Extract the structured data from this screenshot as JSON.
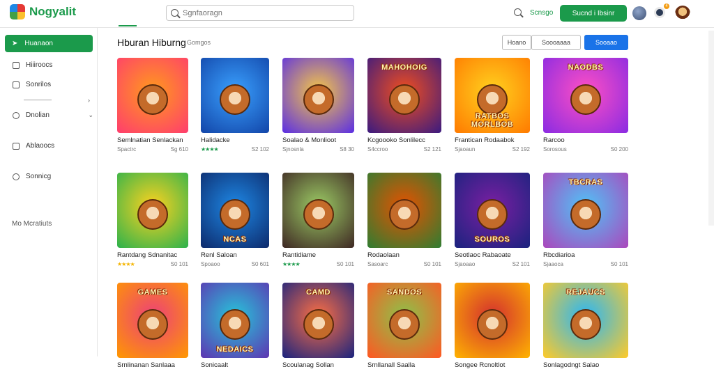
{
  "app": {
    "name": "Nogyalit"
  },
  "search": {
    "placeholder": "Sgnfaoragn"
  },
  "topbar": {
    "link": "Scnsgo",
    "button": "Sucnd i Ibsinr",
    "badge": "4"
  },
  "sidebar": {
    "active": "Huanaon",
    "items": [
      "Hiiiroocs",
      "Sonrilos",
      "Dnolian",
      "Ablaoocs",
      "Sonnicg"
    ],
    "sub": "—————",
    "footer": "Mo Mcratiuts"
  },
  "header": {
    "title": "Hburan Hiburng",
    "subtitle": "Gomgos"
  },
  "chips": [
    "Hoano",
    "Soooaaaa",
    "Sooaao"
  ],
  "colors": {
    "brand": "#1b9a4b",
    "primary": "#1a73e8"
  },
  "games": [
    {
      "title": "Semlnatian Senlackan",
      "rating": "Spactrc",
      "meta": "Sg 610",
      "icon": "bear-mascot-icon",
      "banner": "",
      "palette": [
        "#ff9a1c",
        "#ff3d6e"
      ]
    },
    {
      "title": "Halidacke",
      "rating": "★★★★",
      "meta": "S2 102",
      "icon": "robot-tank-icon",
      "banner": "",
      "palette": [
        "#3aa1ff",
        "#1245a8"
      ]
    },
    {
      "title": "Soalao & Monlioot",
      "rating": "Sjnosnla",
      "meta": "S8 30",
      "icon": "cannon-icon",
      "banner": "",
      "palette": [
        "#f7c845",
        "#5a2ee5"
      ]
    },
    {
      "title": "Kcgoooko Sonlilecc",
      "rating": "S4ccroo",
      "meta": "S2 121",
      "icon": "hero-character-icon",
      "banner": "MAHOHOIG",
      "palette": [
        "#f24e1e",
        "#3a1a80"
      ]
    },
    {
      "title": "Frantican Rodaabok",
      "rating": "Sjaoaun",
      "meta": "S2 192",
      "icon": "bear-tablet-icon",
      "banner": "RATBOS MORLBOB",
      "palette": [
        "#ffd21f",
        "#ff7a00"
      ]
    },
    {
      "title": "Rarcoo",
      "rating": "Sorosous",
      "meta": "S0 200",
      "icon": "bear-mascot-icon",
      "banner": "NAODBS",
      "palette": [
        "#ff4fc4",
        "#8a2be2"
      ]
    },
    {
      "title": "Rantdang Sdnanitac",
      "rating": "★★★★",
      "meta": "S0 101",
      "icon": "dice-icon",
      "banner": "",
      "palette": [
        "#ffd21f",
        "#2bb24c"
      ]
    },
    {
      "title": "Renl Saloan",
      "rating": "Spoaoo",
      "meta": "S0 601",
      "icon": "tablet-icon",
      "banner": "NCAS",
      "palette": [
        "#1e88e5",
        "#0d2a6b"
      ]
    },
    {
      "title": "Rantidiame",
      "rating": "★★★★",
      "meta": "S0 101",
      "icon": "adventurers-icon",
      "banner": "",
      "palette": [
        "#9ccc65",
        "#3e2723"
      ]
    },
    {
      "title": "Rodaolaan",
      "rating": "Sasoarc",
      "meta": "S0 101",
      "icon": "explorer-bear-icon",
      "banner": "",
      "palette": [
        "#e65100",
        "#2e7d32"
      ]
    },
    {
      "title": "Seotlaoc Rabaoate",
      "rating": "Sjaoaao",
      "meta": "S2 101",
      "icon": "hero-character-icon",
      "banner": "SOUROS",
      "palette": [
        "#7b1fa2",
        "#1a237e"
      ]
    },
    {
      "title": "Rbcdiarioa",
      "rating": "Sjaaoca",
      "meta": "S0 101",
      "icon": "cartoon-crowd-icon",
      "banner": "TBCRAS",
      "palette": [
        "#4fc3f7",
        "#ab47bc"
      ]
    },
    {
      "title": "Srnlinanan Sanlaaa",
      "rating": "",
      "meta": "",
      "icon": "bear-mascot-icon",
      "banner": "GAMES",
      "palette": [
        "#ec407a",
        "#ff9800"
      ]
    },
    {
      "title": "Sonicaalt",
      "rating": "",
      "meta": "",
      "icon": "characters-icon",
      "banner": "NEDAICS",
      "palette": [
        "#26c6da",
        "#5e35b1"
      ]
    },
    {
      "title": "Scoulanag Sollan",
      "rating": "",
      "meta": "",
      "icon": "mascot-icon",
      "banner": "CAMD",
      "palette": [
        "#ff7043",
        "#1a237e"
      ]
    },
    {
      "title": "Srnllanall Saalla",
      "rating": "",
      "meta": "",
      "icon": "crowd-icon",
      "banner": "SANDOS",
      "palette": [
        "#8bc34a",
        "#ff5722"
      ]
    },
    {
      "title": "Songee Rcnoltlot",
      "rating": "",
      "meta": "",
      "icon": "bear-mascot-icon",
      "banner": "",
      "palette": [
        "#d32f2f",
        "#ffb300"
      ]
    },
    {
      "title": "Sonlagodngt Salao",
      "rating": "",
      "meta": "",
      "icon": "team-icon",
      "banner": "REJAUCS",
      "palette": [
        "#29b6f6",
        "#ffca28"
      ]
    }
  ]
}
